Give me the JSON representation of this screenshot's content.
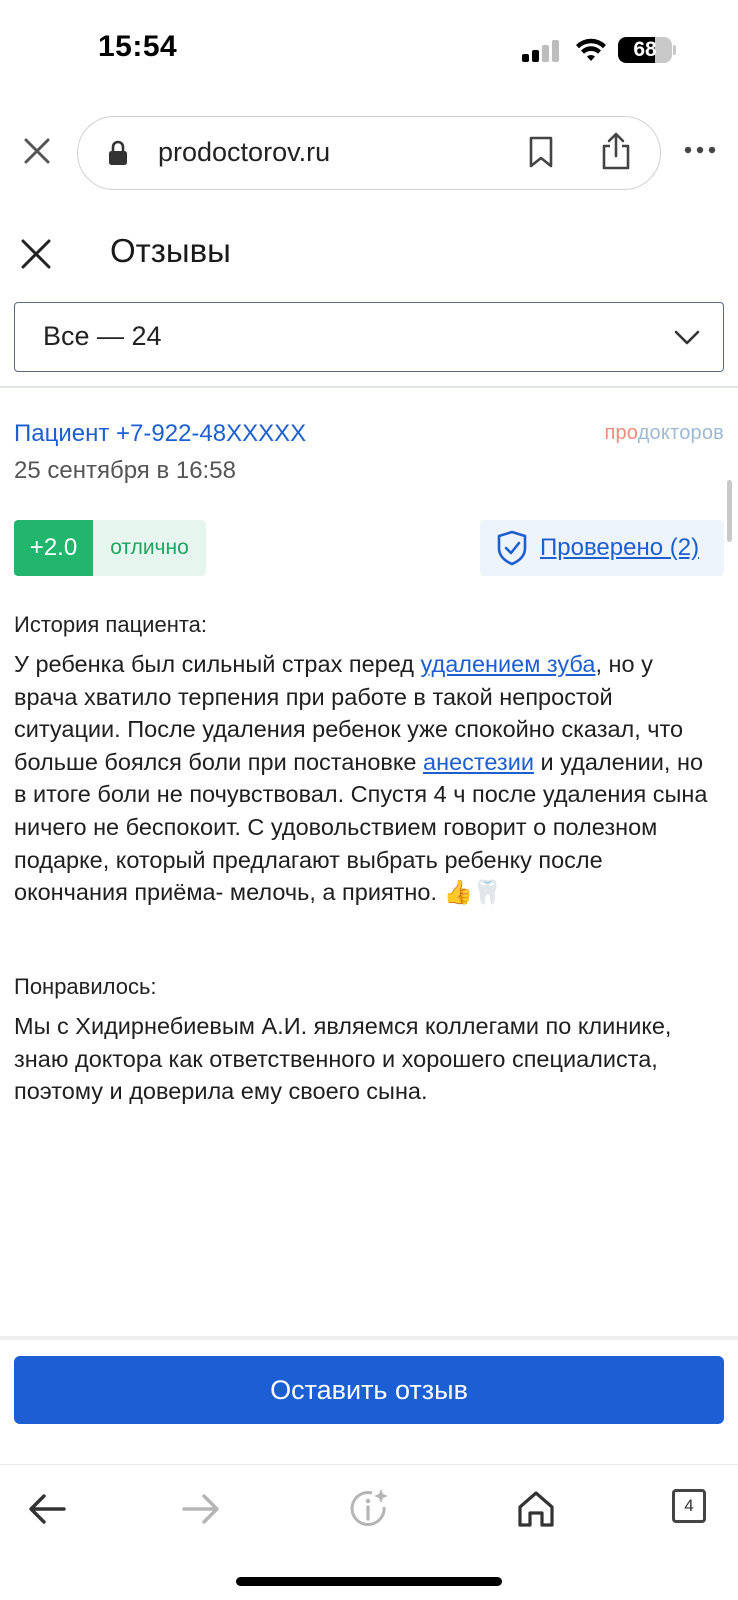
{
  "status": {
    "time": "15:54",
    "battery": "68",
    "battery_level": 0.68
  },
  "browser": {
    "url": "prodoctorov.ru",
    "tabs_count": "4"
  },
  "header": {
    "title": "Отзывы"
  },
  "filter": {
    "value": "Все — 24"
  },
  "review": {
    "author": "Пациент +7-922-48XXXXX",
    "brand_pro": "про",
    "brand_rest": "докторов",
    "date": "25 сентября в 16:58",
    "score": "+2.0",
    "score_label": "отлично",
    "verified": "Проверено (2)",
    "story_title": "История пациента:",
    "story_p1": "У ребенка был сильный страх перед ",
    "story_link1": "удалением зуба",
    "story_p2": ", но у врача хватило терпения при работе в такой непростой ситуации. После удаления ребенок уже спокойно сказал, что больше боялся боли при постановке ",
    "story_link2": "анестезии",
    "story_p3": " и удалении, но в итоге боли не почувствовал. Спустя 4 ч после удаления сына ничего не беспокоит. С удовольствием говорит о полезном подарке, который предлагают выбрать ребенку после окончания приёма- мелочь, а приятно. 👍🦷",
    "liked_title": "Понравилось:",
    "liked_text": "Мы с Хидирнебиевым А.И. являемся коллегами по клинике, знаю доктора как ответственного и хорошего специалиста, поэтому и доверила ему своего сына."
  },
  "cta": {
    "label": "Оставить отзыв"
  },
  "colors": {
    "link": "#1d5fd1",
    "cta": "#1c5fd4",
    "score": "#22b56e"
  }
}
